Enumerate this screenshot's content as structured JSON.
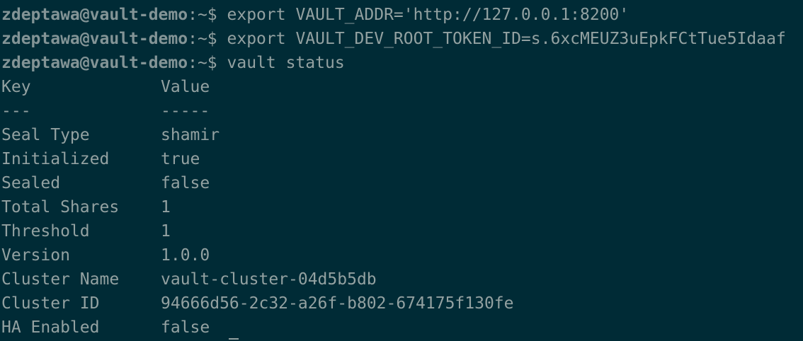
{
  "prompts": [
    {
      "user_host": "zdeptawa@vault-demo",
      "path_sigil": ":~$",
      "command": "export VAULT_ADDR='http://127.0.0.1:8200'"
    },
    {
      "user_host": "zdeptawa@vault-demo",
      "path_sigil": ":~$",
      "command": "export VAULT_DEV_ROOT_TOKEN_ID=s.6xcMEUZ3uEpkFCtTue5Idaaf"
    },
    {
      "user_host": "zdeptawa@vault-demo",
      "path_sigil": ":~$",
      "command": "vault status"
    }
  ],
  "table": {
    "header": {
      "key": "Key",
      "value": "Value"
    },
    "separator": {
      "key": "---",
      "value": "-----"
    },
    "rows": [
      {
        "key": "Seal Type",
        "value": "shamir"
      },
      {
        "key": "Initialized",
        "value": "true"
      },
      {
        "key": "Sealed",
        "value": "false"
      },
      {
        "key": "Total Shares",
        "value": "1"
      },
      {
        "key": "Threshold",
        "value": "1"
      },
      {
        "key": "Version",
        "value": "1.0.0"
      },
      {
        "key": "Cluster Name",
        "value": "vault-cluster-04d5b5db"
      },
      {
        "key": "Cluster ID",
        "value": "94666d56-2c32-a26f-b802-674175f130fe"
      },
      {
        "key": "HA Enabled",
        "value": "false"
      }
    ]
  },
  "colors": {
    "background": "#002b36",
    "text": "#93a1a1",
    "prompt": "#839496"
  }
}
